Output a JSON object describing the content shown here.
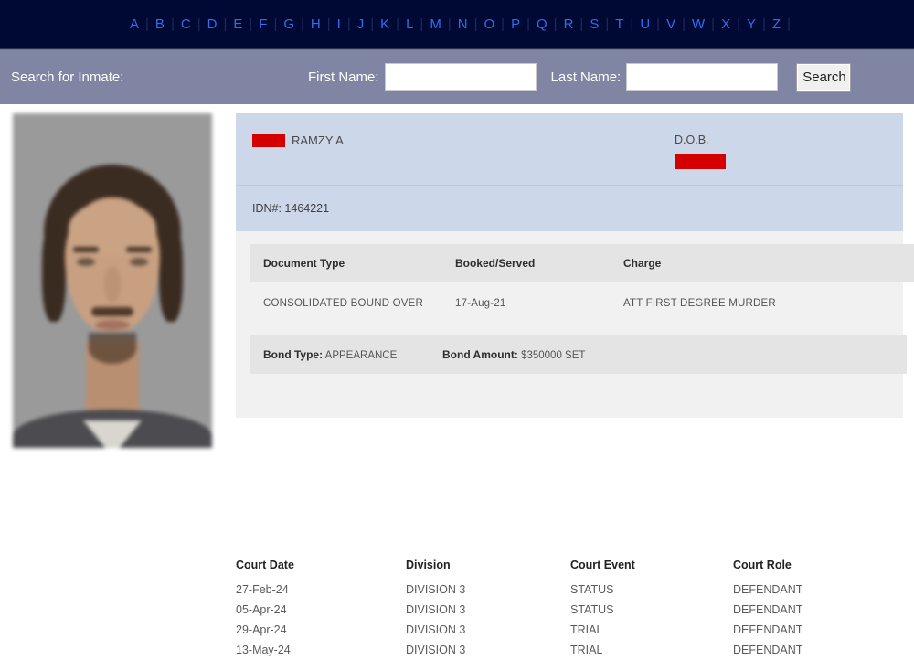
{
  "alphabet_nav": {
    "letters": [
      "A",
      "B",
      "C",
      "D",
      "E",
      "F",
      "G",
      "H",
      "I",
      "J",
      "K",
      "L",
      "M",
      "N",
      "O",
      "P",
      "Q",
      "R",
      "S",
      "T",
      "U",
      "V",
      "W",
      "X",
      "Y",
      "Z"
    ],
    "separator": "|",
    "link_color": "#2f6ef2",
    "background_color": "#000933"
  },
  "search": {
    "title": "Search for Inmate:",
    "first_name_label": "First Name:",
    "first_name_value": "",
    "first_name_placeholder": "",
    "last_name_label": "Last Name:",
    "last_name_value": "",
    "last_name_placeholder": "",
    "button_label": "Search",
    "background_color": "#8085a3"
  },
  "inmate": {
    "name": "RAMZY A",
    "name_redacted": true,
    "dob_label": "D.O.B.",
    "dob_redacted": true,
    "idn": "IDN#: 1464221",
    "redaction_color": "#d40000",
    "panel_color": "#ccd7ea",
    "photo_alt": "inmate-mugshot"
  },
  "charges": {
    "headers": [
      "Document Type",
      "Booked/Served",
      "Charge"
    ],
    "rows": [
      {
        "document_type": "CONSOLIDATED BOUND OVER",
        "booked_served": "17-Aug-21",
        "charge": "ATT FIRST DEGREE MURDER"
      }
    ],
    "bond": {
      "type_label": "Bond Type:",
      "type_value": "APPEARANCE",
      "amount_label": "Bond Amount:",
      "amount_value": "$350000 SET"
    }
  },
  "court_dates": {
    "headers": [
      "Court Date",
      "Division",
      "Court Event",
      "Court Role"
    ],
    "rows": [
      {
        "date": "27-Feb-24",
        "division": "DIVISION 3",
        "event": "STATUS",
        "role": "DEFENDANT"
      },
      {
        "date": "05-Apr-24",
        "division": "DIVISION 3",
        "event": "STATUS",
        "role": "DEFENDANT"
      },
      {
        "date": "29-Apr-24",
        "division": "DIVISION 3",
        "event": "TRIAL",
        "role": "DEFENDANT"
      },
      {
        "date": "13-May-24",
        "division": "DIVISION 3",
        "event": "TRIAL",
        "role": "DEFENDANT"
      }
    ]
  }
}
